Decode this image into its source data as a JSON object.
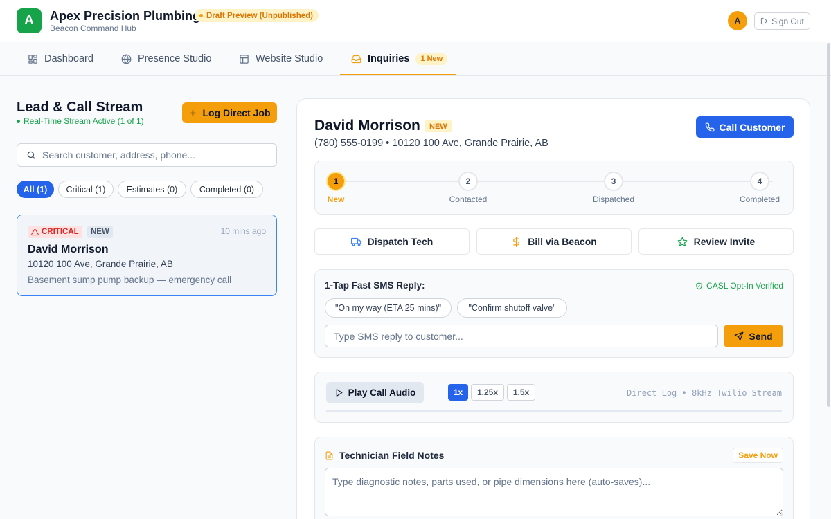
{
  "colors": {
    "brand": "#16a34a",
    "accent": "#f59e0b",
    "primary": "#2563eb",
    "critical": "#dc2626"
  },
  "header": {
    "logo_letter": "A",
    "business_name": "Apex Precision Plumbing",
    "subtitle": "Beacon Command Hub",
    "draft_badge": "Draft Preview (Unpublished)",
    "avatar_letter": "A",
    "sign_out": "Sign Out"
  },
  "nav": {
    "tabs": [
      {
        "label": "Dashboard",
        "icon": "grid-icon"
      },
      {
        "label": "Presence Studio",
        "icon": "globe-icon"
      },
      {
        "label": "Website Studio",
        "icon": "layout-icon"
      },
      {
        "label": "Inquiries",
        "icon": "inbox-icon",
        "badge": "1 New",
        "active": true
      }
    ]
  },
  "stream": {
    "title": "Lead & Call Stream",
    "status": "Real-Time Stream Active (1 of 1)",
    "log_button": "Log Direct Job",
    "search_placeholder": "Search customer, address, phone...",
    "filters": [
      {
        "label": "All (1)",
        "active": true
      },
      {
        "label": "Critical (1)"
      },
      {
        "label": "Estimates (0)"
      },
      {
        "label": "Completed (0)"
      }
    ],
    "leads": [
      {
        "priority": "CRITICAL",
        "status": "NEW",
        "time": "10 mins ago",
        "name": "David Morrison",
        "address": "10120 100 Ave, Grande Prairie, AB",
        "description": "Basement sump pump backup — emergency call"
      }
    ]
  },
  "detail": {
    "name": "David Morrison",
    "status": "NEW",
    "contact": "(780) 555-0199 • 10120 100 Ave, Grande Prairie, AB",
    "call_button": "Call Customer",
    "steps": [
      {
        "num": "1",
        "label": "New",
        "active": true
      },
      {
        "num": "2",
        "label": "Contacted"
      },
      {
        "num": "3",
        "label": "Dispatched"
      },
      {
        "num": "4",
        "label": "Completed"
      }
    ],
    "actions": [
      {
        "label": "Dispatch Tech",
        "icon": "truck-icon"
      },
      {
        "label": "Bill via Beacon",
        "icon": "dollar-icon"
      },
      {
        "label": "Review Invite",
        "icon": "star-icon"
      }
    ],
    "sms": {
      "title": "1-Tap Fast SMS Reply:",
      "casl": "CASL Opt-In Verified",
      "quick_replies": [
        "\"On my way (ETA 25 mins)\"",
        "\"Confirm shutoff valve\""
      ],
      "placeholder": "Type SMS reply to customer...",
      "send": "Send"
    },
    "audio": {
      "play": "Play Call Audio",
      "speeds": [
        {
          "label": "1x",
          "active": true
        },
        {
          "label": "1.25x"
        },
        {
          "label": "1.5x"
        }
      ],
      "meta": "Direct Log • 8kHz Twilio Stream",
      "progress": 0
    },
    "notes": {
      "title": "Technician Field Notes",
      "save": "Save Now",
      "placeholder": "Type diagnostic notes, parts used, or pipe dimensions here (auto-saves)..."
    }
  }
}
